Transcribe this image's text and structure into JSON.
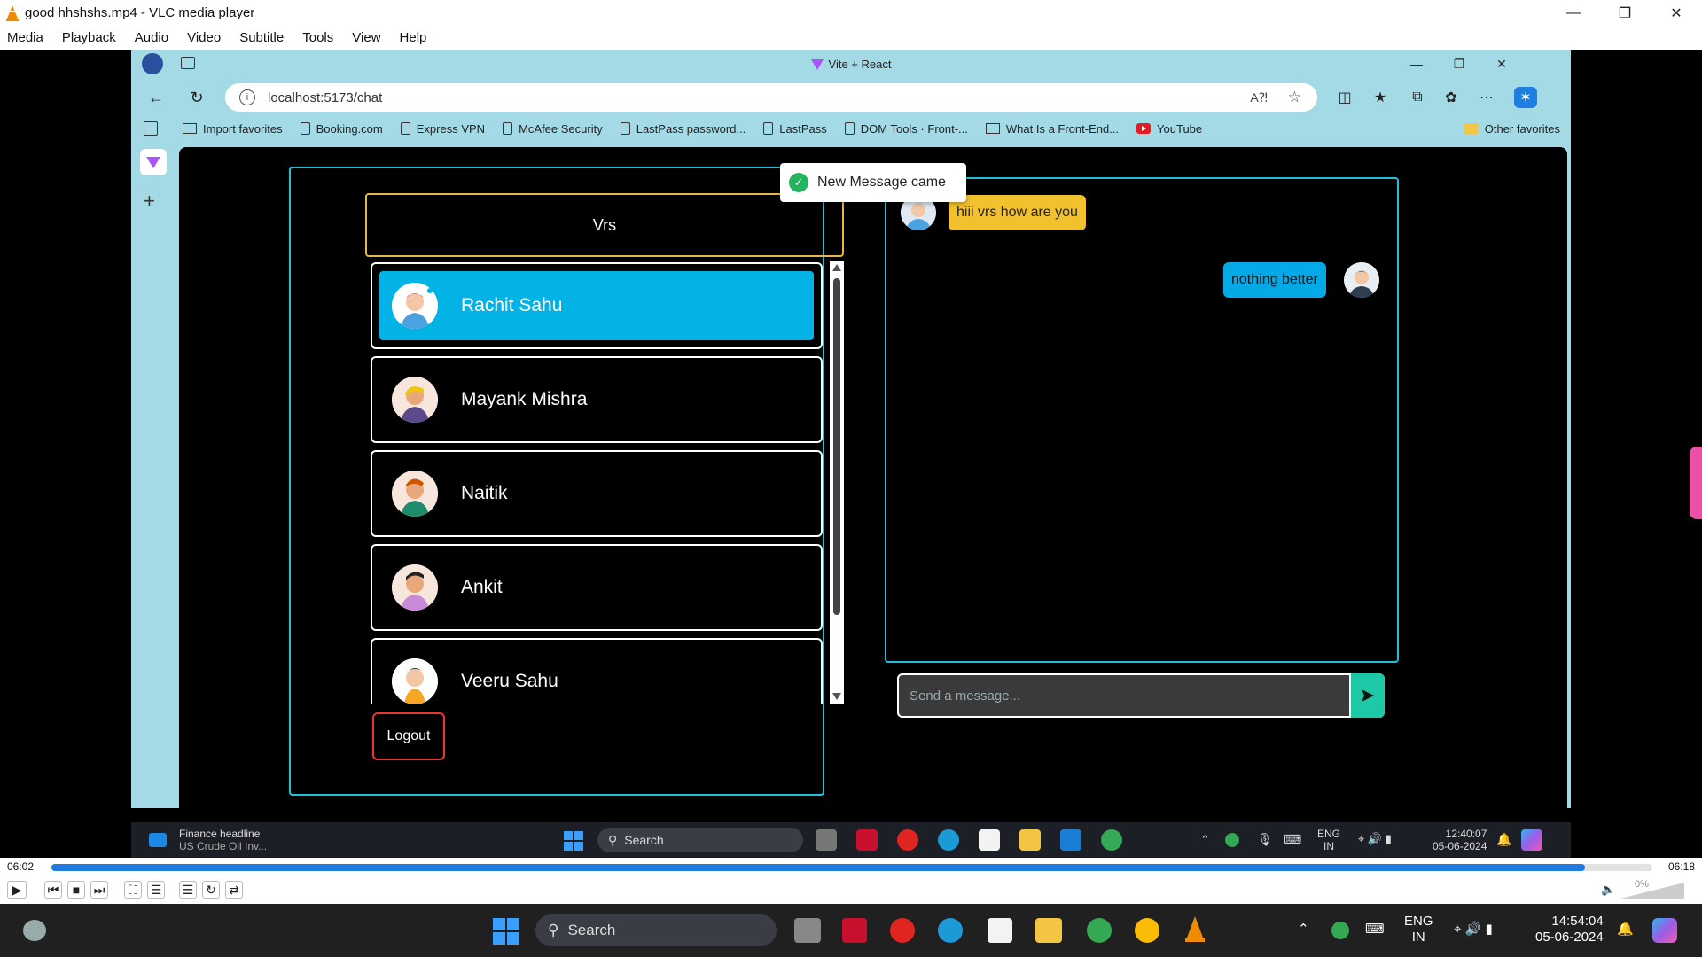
{
  "vlc": {
    "title": "good hhshshs.mp4 - VLC media player",
    "menu": [
      "Media",
      "Playback",
      "Audio",
      "Video",
      "Subtitle",
      "Tools",
      "View",
      "Help"
    ],
    "elapsed": "06:02",
    "total": "06:18",
    "progress_fraction": 0.958,
    "volume": "0%"
  },
  "browser": {
    "tab_title": "Vite + React",
    "url": "localhost:5173/chat",
    "favorites": [
      {
        "label": "Import favorites",
        "icon": "import-icon"
      },
      {
        "label": "Booking.com",
        "icon": "doc-icon"
      },
      {
        "label": "Express VPN",
        "icon": "doc-icon"
      },
      {
        "label": "McAfee Security",
        "icon": "doc-icon"
      },
      {
        "label": "LastPass password...",
        "icon": "doc-icon"
      },
      {
        "label": "LastPass",
        "icon": "doc-icon"
      },
      {
        "label": "DOM Tools · Front-...",
        "icon": "doc-icon"
      },
      {
        "label": "What Is a Front-End...",
        "icon": "book-icon"
      },
      {
        "label": "YouTube",
        "icon": "youtube-icon"
      }
    ],
    "other_favorites": "Other favorites"
  },
  "app": {
    "current_user": "Vrs",
    "users": [
      {
        "name": "Rachit Sahu",
        "active": true,
        "skin": "#f3c6a5",
        "shirt": "#4aa3df",
        "hair": "#c0392b"
      },
      {
        "name": "Mayank Mishra",
        "active": false,
        "skin": "#e8a87c",
        "shirt": "#5b4a8b",
        "hair": "#f1c40f"
      },
      {
        "name": "Naitik",
        "active": false,
        "skin": "#e8a87c",
        "shirt": "#1e8c6b",
        "hair": "#d35400"
      },
      {
        "name": "Ankit",
        "active": false,
        "skin": "#e8a87c",
        "shirt": "#c98bd8",
        "hair": "#222"
      },
      {
        "name": "Veeru Sahu",
        "active": false,
        "skin": "#f3c6a5",
        "shirt": "#f5a623",
        "hair": "#222"
      }
    ],
    "logout_label": "Logout",
    "messages": [
      {
        "text": "hiii vrs how are you",
        "direction": "in"
      },
      {
        "text": "nothing better",
        "direction": "out"
      }
    ],
    "input_placeholder": "Send a message...",
    "toast": "New Message came",
    "colors": {
      "accent": "#04b3e6",
      "panel_border": "#21c0d8",
      "header_border": "#e5b941",
      "incoming": "#f2c12e",
      "send": "#1cc8a6",
      "logout_border": "#ee3333"
    }
  },
  "inner_taskbar": {
    "news_title": "Finance headline",
    "news_sub": "US Crude Oil Inv...",
    "search": "Search",
    "lang": "ENG",
    "region": "IN",
    "time": "12:40:07",
    "date": "05-06-2024"
  },
  "taskbar": {
    "search": "Search",
    "lang": "ENG",
    "region": "IN",
    "time": "14:54:04",
    "date": "05-06-2024"
  }
}
